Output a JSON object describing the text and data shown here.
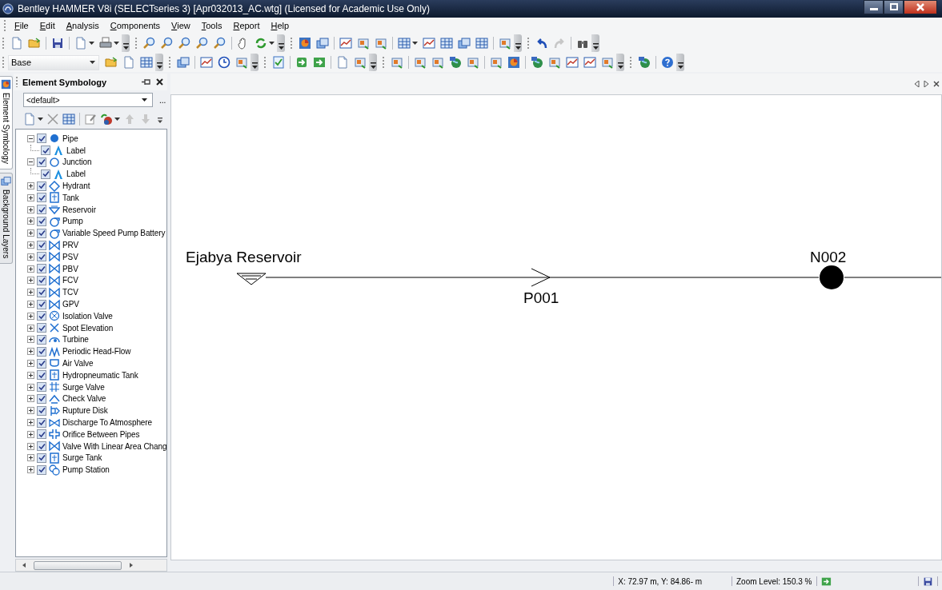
{
  "window": {
    "title": "Bentley HAMMER V8i (SELECTseries 3) [Apr032013_AC.wtg] (Licensed for Academic Use Only)"
  },
  "menu": [
    "File",
    "Edit",
    "Analysis",
    "Components",
    "View",
    "Tools",
    "Report",
    "Help"
  ],
  "toolbar": {
    "layer_dropdown": "Base"
  },
  "side_tabs": [
    {
      "label": "Element Symbology",
      "selected": true
    },
    {
      "label": "Background Layers",
      "selected": false
    }
  ],
  "panel": {
    "title": "Element Symbology",
    "profile_dropdown": "<default>",
    "more_button": "...",
    "tree": [
      {
        "label": "Pipe",
        "kind": "pipe",
        "checked": true,
        "expanded": true,
        "children": [
          {
            "label": "Label",
            "kind": "label",
            "checked": true
          }
        ]
      },
      {
        "label": "Junction",
        "kind": "junction",
        "checked": true,
        "expanded": true,
        "children": [
          {
            "label": "Label",
            "kind": "label",
            "checked": true
          }
        ]
      },
      {
        "label": "Hydrant",
        "kind": "hydrant",
        "checked": true,
        "expanded": false
      },
      {
        "label": "Tank",
        "kind": "tank",
        "checked": true,
        "expanded": false
      },
      {
        "label": "Reservoir",
        "kind": "reservoir",
        "checked": true,
        "expanded": false
      },
      {
        "label": "Pump",
        "kind": "pump",
        "checked": true,
        "expanded": false
      },
      {
        "label": "Variable Speed Pump Battery",
        "kind": "pump-battery",
        "checked": true,
        "expanded": false
      },
      {
        "label": "PRV",
        "kind": "valve",
        "checked": true,
        "expanded": false
      },
      {
        "label": "PSV",
        "kind": "valve",
        "checked": true,
        "expanded": false
      },
      {
        "label": "PBV",
        "kind": "valve",
        "checked": true,
        "expanded": false
      },
      {
        "label": "FCV",
        "kind": "valve",
        "checked": true,
        "expanded": false
      },
      {
        "label": "TCV",
        "kind": "valve",
        "checked": true,
        "expanded": false
      },
      {
        "label": "GPV",
        "kind": "valve",
        "checked": true,
        "expanded": false
      },
      {
        "label": "Isolation Valve",
        "kind": "isolation-valve",
        "checked": true,
        "expanded": false
      },
      {
        "label": "Spot Elevation",
        "kind": "spot-elevation",
        "checked": true,
        "expanded": false
      },
      {
        "label": "Turbine",
        "kind": "turbine",
        "checked": true,
        "expanded": false
      },
      {
        "label": "Periodic Head-Flow",
        "kind": "periodic",
        "checked": true,
        "expanded": false
      },
      {
        "label": "Air Valve",
        "kind": "air-valve",
        "checked": true,
        "expanded": false
      },
      {
        "label": "Hydropneumatic Tank",
        "kind": "hydro-tank",
        "checked": true,
        "expanded": false
      },
      {
        "label": "Surge Valve",
        "kind": "surge-valve",
        "checked": true,
        "expanded": false
      },
      {
        "label": "Check Valve",
        "kind": "check-valve",
        "checked": true,
        "expanded": false
      },
      {
        "label": "Rupture Disk",
        "kind": "rupture-disk",
        "checked": true,
        "expanded": false
      },
      {
        "label": "Discharge To Atmosphere",
        "kind": "discharge",
        "checked": true,
        "expanded": false
      },
      {
        "label": "Orifice Between Pipes",
        "kind": "orifice",
        "checked": true,
        "expanded": false
      },
      {
        "label": "Valve With Linear Area Chang",
        "kind": "valve",
        "checked": true,
        "expanded": false
      },
      {
        "label": "Surge Tank",
        "kind": "tank",
        "checked": true,
        "expanded": false
      },
      {
        "label": "Pump Station",
        "kind": "pump-station",
        "checked": true,
        "expanded": false
      }
    ]
  },
  "canvas": {
    "elements": [
      {
        "kind": "reservoir",
        "label": "Ejabya Reservoir"
      },
      {
        "kind": "pipe",
        "label": "P001"
      },
      {
        "kind": "junction",
        "label": "N002"
      }
    ]
  },
  "status_bar": {
    "coordinates": "X: 72.97 m, Y: 84.86- m",
    "zoom": "Zoom Level: 150.3 %"
  }
}
